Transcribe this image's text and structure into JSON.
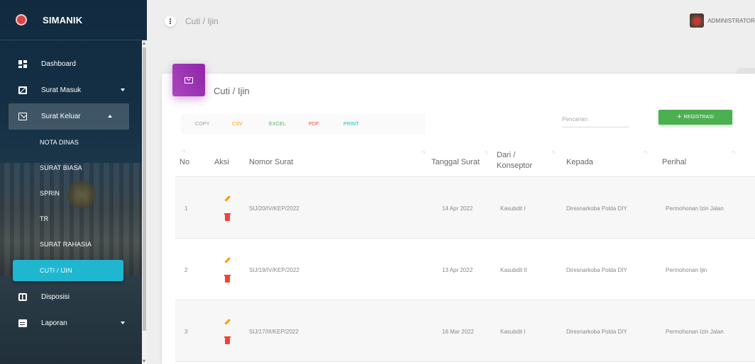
{
  "app": {
    "name": "SIMANIK"
  },
  "sidebar": {
    "items": [
      {
        "label": "Dashboard",
        "icon": "dashboard-icon"
      },
      {
        "label": "Surat Masuk",
        "icon": "inbox-icon"
      },
      {
        "label": "Surat Keluar",
        "icon": "mail-icon"
      },
      {
        "label": "Disposisi",
        "icon": "disposisi-icon"
      },
      {
        "label": "Laporan",
        "icon": "report-icon"
      }
    ],
    "submenu": [
      "NOTA DINAS",
      "SURAT BIASA",
      "SPRIN",
      "TR",
      "SURAT RAHASIA",
      "CUTI / IJIN"
    ]
  },
  "topbar": {
    "breadcrumb": "Cuti / Ijin",
    "user": "ADMINISTRATOR"
  },
  "card": {
    "title": "Cuti / Ijin",
    "export_buttons": [
      {
        "label": "COPY",
        "color": "#999999"
      },
      {
        "label": "CSV",
        "color": "#ff9800"
      },
      {
        "label": "EXCEL",
        "color": "#4caf50"
      },
      {
        "label": "PDF",
        "color": "#f44336"
      },
      {
        "label": "PRINT",
        "color": "#00bcd4"
      }
    ],
    "search_placeholder": "Pencarian",
    "register_label": "REGISTRASI"
  },
  "table": {
    "headers": {
      "no": "No",
      "aksi": "Aksi",
      "nomor": "Nomor Surat",
      "tanggal": "Tanggal Surat",
      "dari_1": "Dari /",
      "dari_2": "Konseptor",
      "kepada": "Kepada",
      "perihal": "Perihal"
    },
    "rows": [
      {
        "no": "1",
        "nomor": "SIJ/20/IV/KEP/2022",
        "tanggal": "14 Apr 2022",
        "dari": "Kasubdit I",
        "kepada": "Diresnarkoba Polda DIY",
        "perihal": "Permohonan Izin Jalan"
      },
      {
        "no": "2",
        "nomor": "SIJ/19/IV/KEP/2022",
        "tanggal": "13 Apr 2022",
        "dari": "Kasubdit II",
        "kepada": "Diresnarkoba Polda DIY",
        "perihal": "Permohonan Ijin"
      },
      {
        "no": "3",
        "nomor": "SIJ/17/III/KEP/2022",
        "tanggal": "16 Mar 2022",
        "dari": "Kasubdit I",
        "kepada": "Diresnarkoba Polda DIY",
        "perihal": "Permohonan Izin Jalan"
      }
    ]
  },
  "colors": {
    "accent": "#1fb6d0",
    "card_icon": "#9c27b0",
    "register": "#4caf50",
    "edit": "#ff9800",
    "delete": "#f44336"
  }
}
